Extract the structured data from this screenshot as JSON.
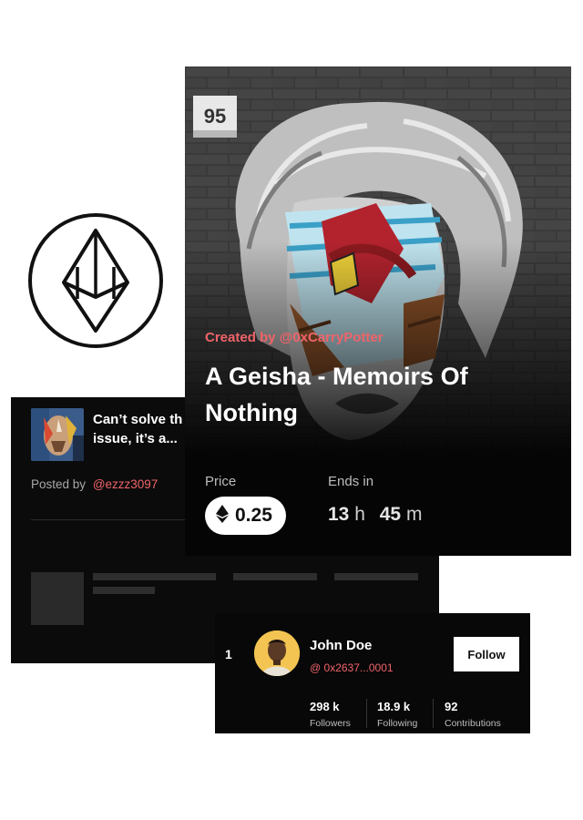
{
  "post": {
    "title": "Can’t solve th\nissue, it’s a...",
    "posted_by_label": "Posted by",
    "posted_by_handle": "@ezzz3097"
  },
  "nft": {
    "wall_number": "95",
    "creator": "Created by @0xCarryPotter",
    "title": "A Geisha - Memoirs Of Nothing",
    "price_label": "Price",
    "price_value": "0.25",
    "ends_label": "Ends in",
    "ends_hours": "13",
    "ends_hours_unit": "h",
    "ends_minutes": "45",
    "ends_minutes_unit": "m"
  },
  "profile": {
    "rank": "1",
    "name": "John Doe",
    "address": "@ 0x2637...0001",
    "follow_label": "Follow",
    "stats": [
      {
        "value": "298 k",
        "label": "Followers"
      },
      {
        "value": "18.9 k",
        "label": "Following"
      },
      {
        "value": "92",
        "label": "Contributions"
      }
    ]
  },
  "icons": {
    "ethereum_badge": "ethereum-icon",
    "price_currency": "ethereum-icon"
  },
  "colors": {
    "accent": "#f0646a",
    "card_bg": "#0b0b0b"
  }
}
